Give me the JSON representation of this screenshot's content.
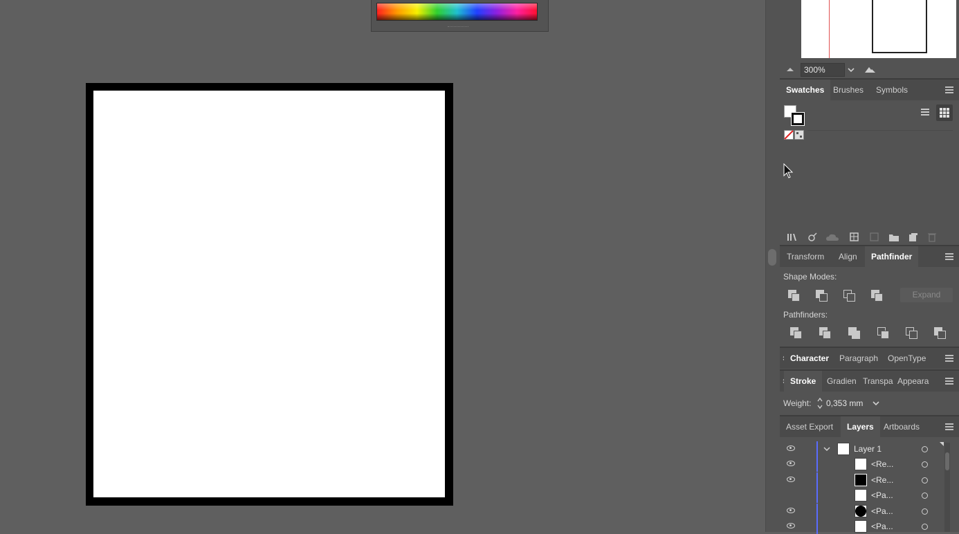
{
  "navigator": {
    "zoom": "300%"
  },
  "swatches_panel": {
    "tabs": [
      "Swatches",
      "Brushes",
      "Symbols"
    ],
    "active": "Swatches"
  },
  "pathfinder_panel": {
    "tabs": [
      "Transform",
      "Align",
      "Pathfinder"
    ],
    "active": "Pathfinder",
    "shape_modes_label": "Shape Modes:",
    "pathfinders_label": "Pathfinders:",
    "expand_label": "Expand"
  },
  "character_panel": {
    "tabs": [
      "Character",
      "Paragraph",
      "OpenType"
    ]
  },
  "stroke_panel": {
    "tabs": [
      "Stroke",
      "Gradien",
      "Transpa",
      "Appeara"
    ],
    "weight_label": "Weight:",
    "weight_value": "0,353 mm"
  },
  "layers_panel": {
    "tabs": [
      "Asset Export",
      "Layers",
      "Artboards"
    ],
    "active": "Layers",
    "layer_name": "Layer 1",
    "items": [
      {
        "label": "<Re...",
        "thumb": "white",
        "visible": true
      },
      {
        "label": "<Re...",
        "thumb": "black",
        "visible": true
      },
      {
        "label": "<Pa...",
        "thumb": "white",
        "visible": false
      },
      {
        "label": "<Pa...",
        "thumb": "circle",
        "visible": true
      },
      {
        "label": "<Pa...",
        "thumb": "white",
        "visible": true
      }
    ]
  },
  "colors": {
    "canvas_bg": "#5f5f5f",
    "panel_bg": "#535353",
    "layer_color": "#5a6cff"
  }
}
